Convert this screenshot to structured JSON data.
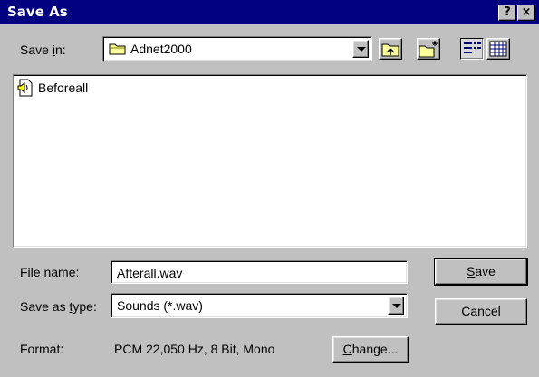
{
  "window": {
    "title": "Save As",
    "help_button": "?",
    "close_button": "×"
  },
  "save_in": {
    "label_pre": "Save ",
    "label_key": "i",
    "label_post": "n:",
    "value": "Adnet2000"
  },
  "toolbar": {
    "up_icon": "up-one-level-icon",
    "new_folder_icon": "new-folder-icon",
    "list_icon": "list-view-icon",
    "details_icon": "details-view-icon"
  },
  "file_list": {
    "items": [
      {
        "name": "Beforeall",
        "icon": "sound-file-icon"
      }
    ]
  },
  "file_name": {
    "label_pre": "File ",
    "label_key": "n",
    "label_post": "ame:",
    "value": "Afterall.wav"
  },
  "save_as_type": {
    "label_pre": "Save as ",
    "label_key": "t",
    "label_post": "ype:",
    "value": "Sounds (*.wav)"
  },
  "format": {
    "label": "Format:",
    "value": "PCM 22,050 Hz, 8 Bit, Mono"
  },
  "buttons": {
    "save_key": "S",
    "save_rest": "ave",
    "cancel": "Cancel",
    "change_key": "C",
    "change_rest": "hange..."
  }
}
